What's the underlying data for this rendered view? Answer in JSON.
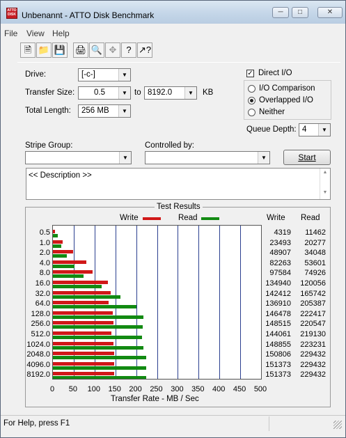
{
  "window": {
    "title": "Unbenannt - ATTO Disk Benchmark",
    "icon_text": "ATTO DISK BENCH"
  },
  "menu": [
    "File",
    "View",
    "Help"
  ],
  "form": {
    "drive_label": "Drive:",
    "drive_value": "[-c-]",
    "transfer_size_label": "Transfer Size:",
    "transfer_from": "0.5",
    "to_label": "to",
    "transfer_to": "8192.0",
    "kb_label": "KB",
    "total_length_label": "Total Length:",
    "total_length_value": "256 MB",
    "direct_io_label": "Direct I/O",
    "direct_io_checked": true,
    "io_comparison_label": "I/O Comparison",
    "overlapped_io_label": "Overlapped I/O",
    "neither_label": "Neither",
    "io_mode_selected": "Overlapped I/O",
    "queue_depth_label": "Queue Depth:",
    "queue_depth_value": "4",
    "stripe_group_label": "Stripe Group:",
    "stripe_group_value": "",
    "controlled_by_label": "Controlled by:",
    "controlled_by_value": "",
    "start_label": "Start",
    "description_text": "<< Description >>"
  },
  "results": {
    "title": "Test Results",
    "write_legend": "Write",
    "read_legend": "Read",
    "write_col": "Write",
    "read_col": "Read",
    "xlabel": "Transfer Rate - MB / Sec",
    "write_color": "#d01818",
    "read_color": "#128a12"
  },
  "chart_data": {
    "type": "bar",
    "title": "Test Results",
    "xlabel": "Transfer Rate - MB / Sec",
    "xlim": [
      0,
      500
    ],
    "xticks": [
      "0",
      "50",
      "100",
      "150",
      "200",
      "250",
      "300",
      "350",
      "400",
      "450",
      "500"
    ],
    "categories": [
      "0.5",
      "1.0",
      "2.0",
      "4.0",
      "8.0",
      "16.0",
      "32.0",
      "64.0",
      "128.0",
      "256.0",
      "512.0",
      "1024.0",
      "2048.0",
      "4096.0",
      "8192.0"
    ],
    "series": [
      {
        "name": "Write",
        "values": [
          4319,
          23493,
          48907,
          82263,
          97584,
          134940,
          142412,
          136910,
          146478,
          148515,
          144061,
          148855,
          150806,
          151373,
          151373
        ]
      },
      {
        "name": "Read",
        "values": [
          11462,
          20277,
          34048,
          53601,
          74926,
          120056,
          165742,
          205387,
          222417,
          220547,
          219130,
          223231,
          229432,
          229432,
          229432
        ]
      }
    ]
  },
  "status": {
    "text": "For Help, press F1"
  }
}
